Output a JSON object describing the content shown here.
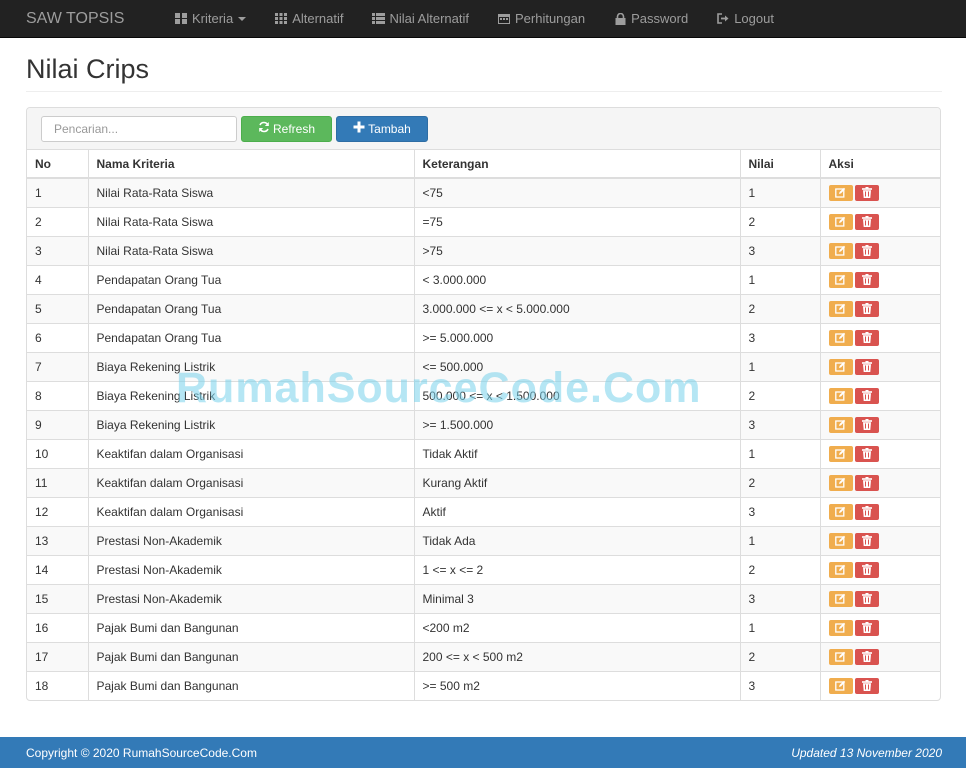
{
  "navbar": {
    "brand": "SAW TOPSIS",
    "items": [
      {
        "label": "Kriteria",
        "icon": "grid-icon",
        "dropdown": true
      },
      {
        "label": "Alternatif",
        "icon": "th-icon",
        "dropdown": false
      },
      {
        "label": "Nilai Alternatif",
        "icon": "list-icon",
        "dropdown": false
      },
      {
        "label": "Perhitungan",
        "icon": "calendar-icon",
        "dropdown": false
      },
      {
        "label": "Password",
        "icon": "lock-icon",
        "dropdown": false
      },
      {
        "label": "Logout",
        "icon": "logout-icon",
        "dropdown": false
      }
    ]
  },
  "page": {
    "title": "Nilai Crips"
  },
  "toolbar": {
    "search_placeholder": "Pencarian...",
    "refresh_label": "Refresh",
    "add_label": "Tambah"
  },
  "table": {
    "headers": [
      "No",
      "Nama Kriteria",
      "Keterangan",
      "Nilai",
      "Aksi"
    ],
    "rows": [
      [
        "1",
        "Nilai Rata-Rata Siswa",
        "<75",
        "1"
      ],
      [
        "2",
        "Nilai Rata-Rata Siswa",
        "=75",
        "2"
      ],
      [
        "3",
        "Nilai Rata-Rata Siswa",
        ">75",
        "3"
      ],
      [
        "4",
        "Pendapatan Orang Tua",
        "< 3.000.000",
        "1"
      ],
      [
        "5",
        "Pendapatan Orang Tua",
        "3.000.000 <= x < 5.000.000",
        "2"
      ],
      [
        "6",
        "Pendapatan Orang Tua",
        ">= 5.000.000",
        "3"
      ],
      [
        "7",
        "Biaya Rekening Listrik",
        "<= 500.000",
        "1"
      ],
      [
        "8",
        "Biaya Rekening Listrik",
        "500.000 <= x < 1.500.000",
        "2"
      ],
      [
        "9",
        "Biaya Rekening Listrik",
        ">= 1.500.000",
        "3"
      ],
      [
        "10",
        "Keaktifan dalam Organisasi",
        "Tidak Aktif",
        "1"
      ],
      [
        "11",
        "Keaktifan dalam Organisasi",
        "Kurang Aktif",
        "2"
      ],
      [
        "12",
        "Keaktifan dalam Organisasi",
        "Aktif",
        "3"
      ],
      [
        "13",
        "Prestasi Non-Akademik",
        "Tidak Ada",
        "1"
      ],
      [
        "14",
        "Prestasi Non-Akademik",
        "1 <= x <= 2",
        "2"
      ],
      [
        "15",
        "Prestasi Non-Akademik",
        "Minimal 3",
        "3"
      ],
      [
        "16",
        "Pajak Bumi dan Bangunan",
        "<200 m2",
        "1"
      ],
      [
        "17",
        "Pajak Bumi dan Bangunan",
        "200 <= x < 500 m2",
        "2"
      ],
      [
        "18",
        "Pajak Bumi dan Bangunan",
        ">= 500 m2",
        "3"
      ]
    ]
  },
  "watermark": "RumahSourceCode.Com",
  "footer": {
    "copyright": "Copyright © 2020 RumahSourceCode.Com",
    "updated": "Updated 13 November 2020"
  },
  "colors": {
    "navbar": "#222222",
    "success": "#5cb85c",
    "primary": "#337ab7",
    "warning": "#f0ad4e",
    "danger": "#d9534f"
  }
}
